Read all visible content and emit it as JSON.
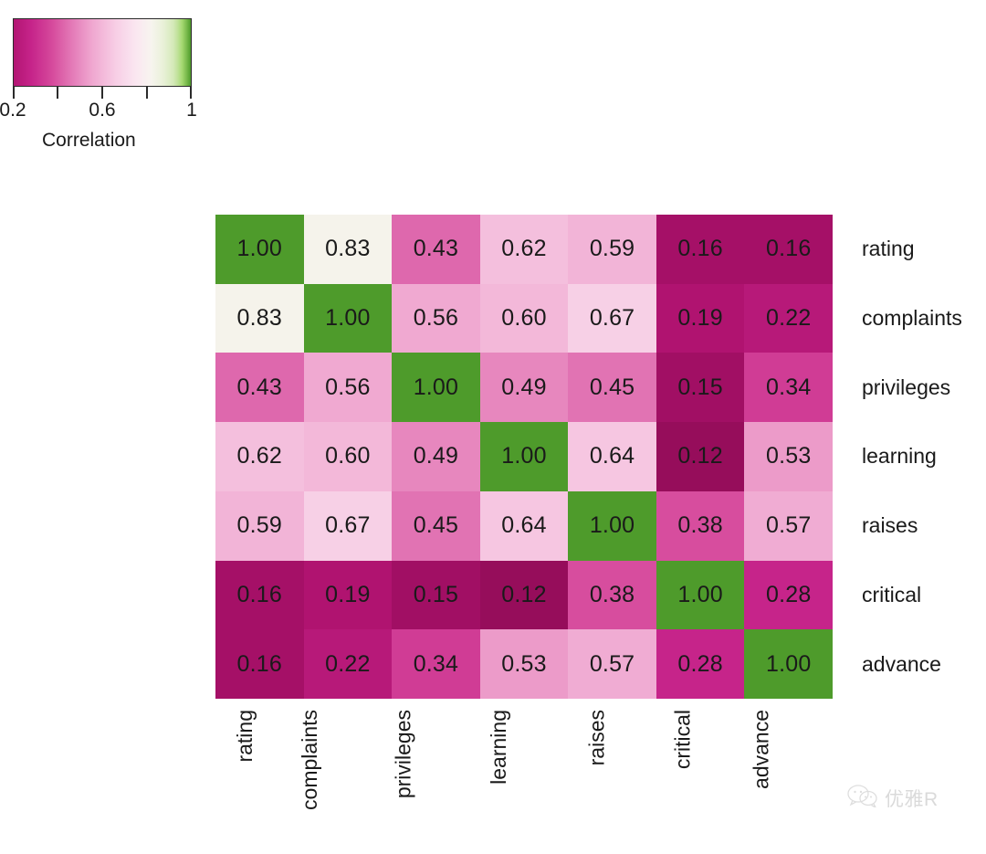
{
  "legend": {
    "title": "Correlation",
    "tick_values": [
      0.2,
      0.4,
      0.6,
      0.8,
      1.0
    ],
    "tick_labels": [
      "0.2",
      "",
      "0.6",
      "",
      "1"
    ],
    "gradient_low_color": "#C2248A",
    "gradient_mid_color": "#F7F4EF",
    "gradient_high_color": "#4E9B2B"
  },
  "watermark": {
    "text": "优雅R",
    "icon": "wechat-icon"
  },
  "chart_data": {
    "type": "heatmap",
    "title": "",
    "xlabel": "",
    "ylabel": "",
    "colorbar_label": "Correlation",
    "colorbar_range": [
      0.2,
      1.0
    ],
    "colorbar_ticks": [
      0.2,
      0.4,
      0.6,
      0.8,
      1.0
    ],
    "colorbar_tick_labels": [
      "0.2",
      "",
      "0.6",
      "",
      "1"
    ],
    "grid": false,
    "legend_position": "top-left",
    "x_categories": [
      "rating",
      "complaints",
      "privileges",
      "learning",
      "raises",
      "critical",
      "advance"
    ],
    "y_categories": [
      "rating",
      "complaints",
      "privileges",
      "learning",
      "raises",
      "critical",
      "advance"
    ],
    "values": [
      [
        1.0,
        0.83,
        0.43,
        0.62,
        0.59,
        0.16,
        0.16
      ],
      [
        0.83,
        1.0,
        0.56,
        0.6,
        0.67,
        0.19,
        0.22
      ],
      [
        0.43,
        0.56,
        1.0,
        0.49,
        0.45,
        0.15,
        0.34
      ],
      [
        0.62,
        0.6,
        0.49,
        1.0,
        0.64,
        0.12,
        0.53
      ],
      [
        0.59,
        0.67,
        0.45,
        0.64,
        1.0,
        0.38,
        0.57
      ],
      [
        0.16,
        0.19,
        0.15,
        0.12,
        0.38,
        1.0,
        0.28
      ],
      [
        0.16,
        0.22,
        0.34,
        0.53,
        0.57,
        0.28,
        1.0
      ]
    ],
    "cell_labels": [
      [
        "1.00",
        "0.83",
        "0.43",
        "0.62",
        "0.59",
        "0.16",
        "0.16"
      ],
      [
        "0.83",
        "1.00",
        "0.56",
        "0.60",
        "0.67",
        "0.19",
        "0.22"
      ],
      [
        "0.43",
        "0.56",
        "1.00",
        "0.49",
        "0.45",
        "0.15",
        "0.34"
      ],
      [
        "0.62",
        "0.60",
        "0.49",
        "1.00",
        "0.64",
        "0.12",
        "0.53"
      ],
      [
        "0.59",
        "0.67",
        "0.45",
        "0.64",
        "1.00",
        "0.38",
        "0.57"
      ],
      [
        "0.16",
        "0.19",
        "0.15",
        "0.12",
        "0.38",
        "1.00",
        "0.28"
      ],
      [
        "0.16",
        "0.22",
        "0.34",
        "0.53",
        "0.57",
        "0.28",
        "1.00"
      ]
    ]
  }
}
